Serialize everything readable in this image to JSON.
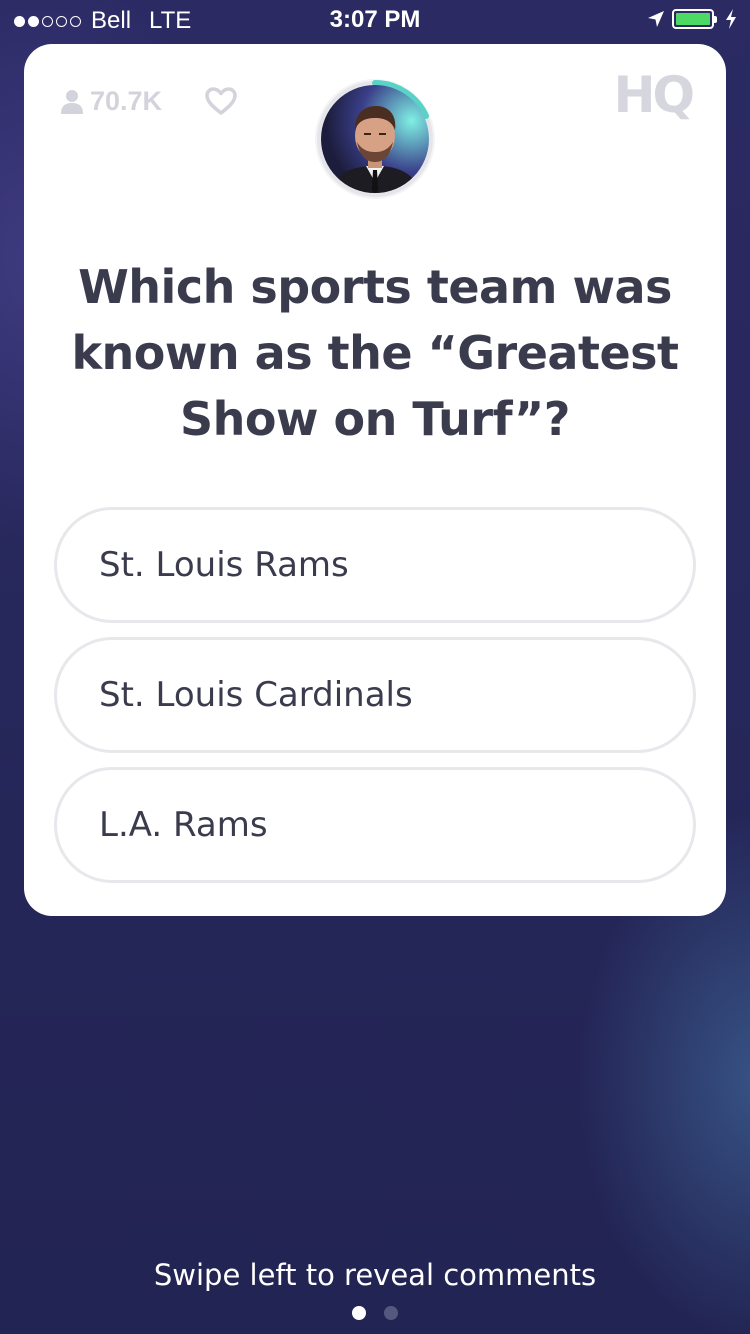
{
  "status_bar": {
    "carrier": "Bell",
    "network": "LTE",
    "time": "3:07 PM",
    "signal_bars": [
      true,
      true,
      false,
      false,
      false
    ],
    "battery_color": "#4cd964",
    "icons": [
      "location-arrow-icon",
      "battery-icon",
      "charging-bolt-icon"
    ]
  },
  "header": {
    "viewer_count": "70.7K",
    "logo_text": "HQ"
  },
  "host": {
    "timer_color": "#5ad2c8"
  },
  "question": {
    "text": "Which sports team was known as the “Greatest Show on Turf”?"
  },
  "answers": [
    {
      "label": "St. Louis Rams"
    },
    {
      "label": "St. Louis Cardinals"
    },
    {
      "label": "L.A. Rams"
    }
  ],
  "footer": {
    "hint": "Swipe left to reveal comments",
    "pages": 2,
    "active_page": 1
  },
  "colors": {
    "background": "#26275a",
    "question_text": "#3a3b4d",
    "muted": "#d3d3dc"
  }
}
